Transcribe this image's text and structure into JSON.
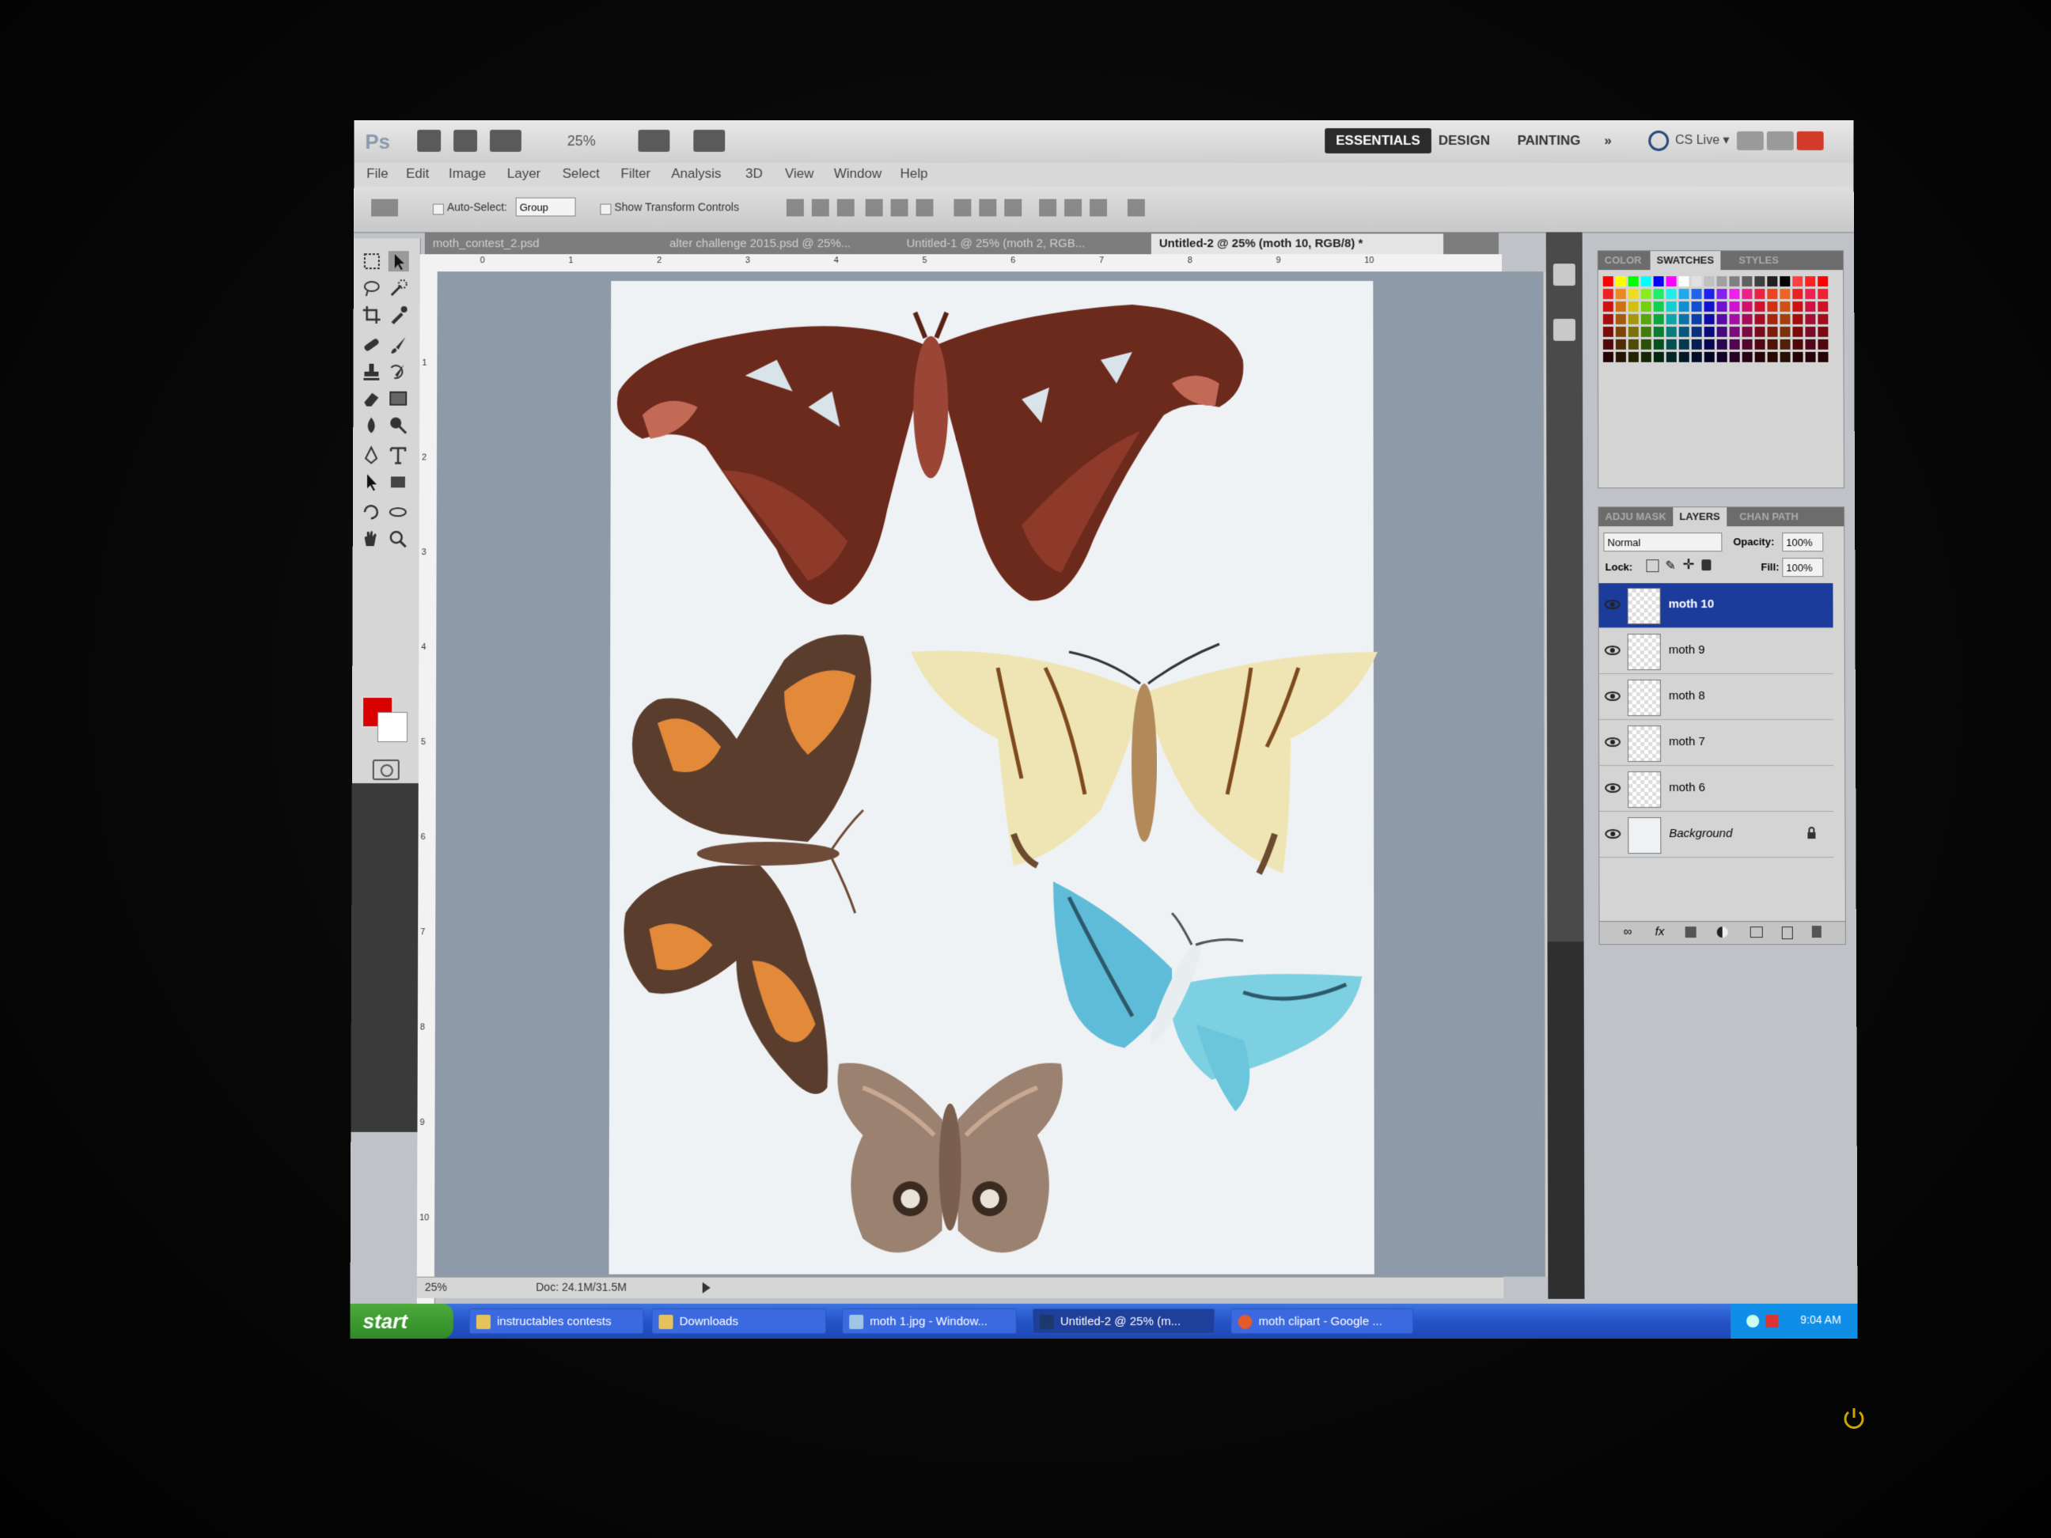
{
  "app": {
    "logo": "Ps",
    "zoom": "25%",
    "workspaces": [
      "ESSENTIALS",
      "DESIGN",
      "PAINTING"
    ],
    "more": "»",
    "cs_live": "CS Live ▾"
  },
  "menu": [
    "File",
    "Edit",
    "Image",
    "Layer",
    "Select",
    "Filter",
    "Analysis",
    "3D",
    "View",
    "Window",
    "Help"
  ],
  "options": {
    "auto_select_label": "Auto-Select:",
    "auto_select_value": "Group",
    "show_transform_label": "Show Transform Controls"
  },
  "tabs": [
    {
      "label": "moth_contest_2.psd"
    },
    {
      "label": "alter challenge 2015.psd @ 25%..."
    },
    {
      "label": "Untitled-1 @ 25% (moth 2, RGB..."
    },
    {
      "label": "Untitled-2 @ 25% (moth 10, RGB/8) *",
      "active": true
    }
  ],
  "rulers": {
    "h": [
      "0",
      "1",
      "2",
      "3",
      "4",
      "5",
      "6",
      "7",
      "8",
      "9",
      "10"
    ],
    "v": [
      "1",
      "2",
      "3",
      "4",
      "5",
      "6",
      "7",
      "8",
      "9",
      "10"
    ]
  },
  "colors": {
    "foreground": "#d90000",
    "background": "#ffffff",
    "selected_layer": "#1c3c9c",
    "taskbar": "#2554c8"
  },
  "status": {
    "zoom": "25%",
    "doc": "Doc: 24.1M/31.5M"
  },
  "swatches_panel": {
    "tabs": [
      "COLOR",
      "SWATCHES",
      "STYLES"
    ],
    "active": "SWATCHES"
  },
  "layers_panel": {
    "tabs": [
      "ADJU MASK",
      "LAYERS",
      "CHAN PATH"
    ],
    "blend_mode": "Normal",
    "opacity_label": "Opacity:",
    "opacity": "100%",
    "lock_label": "Lock:",
    "fill_label": "Fill:",
    "fill": "100%",
    "layers": [
      {
        "name": "moth 10",
        "selected": true
      },
      {
        "name": "moth 9"
      },
      {
        "name": "moth 8"
      },
      {
        "name": "moth 7"
      },
      {
        "name": "moth 6"
      },
      {
        "name": "Background",
        "locked": true
      }
    ]
  },
  "taskbar": {
    "start": "start",
    "tasks": [
      {
        "label": "instructables contests"
      },
      {
        "label": "Downloads"
      },
      {
        "label": "moth 1.jpg - Window..."
      },
      {
        "label": "Untitled-2 @ 25% (m...",
        "active": true
      },
      {
        "label": "moth clipart - Google ..."
      }
    ],
    "clock": "9:04 AM"
  }
}
